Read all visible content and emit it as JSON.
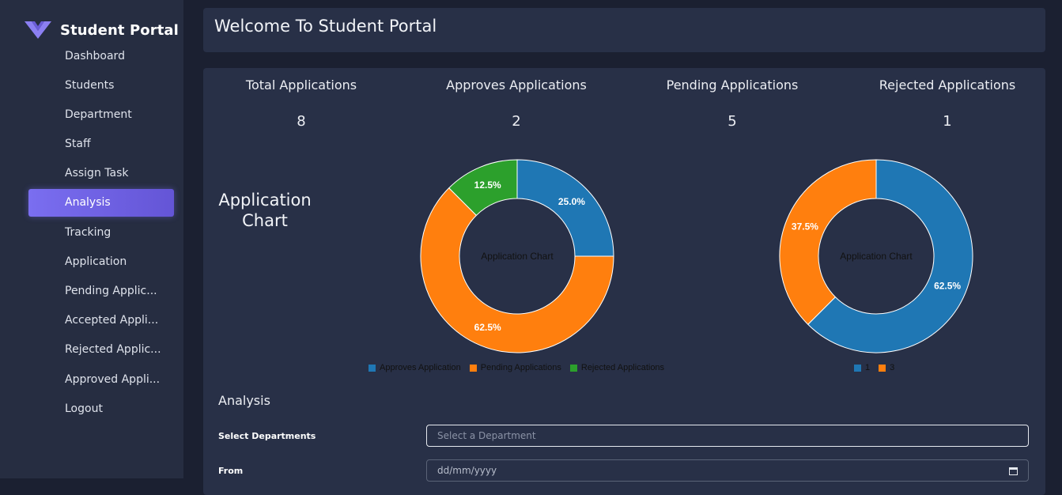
{
  "sidebar": {
    "brand": "Student Portal",
    "items": [
      {
        "label": "Dashboard"
      },
      {
        "label": "Students"
      },
      {
        "label": "Department"
      },
      {
        "label": "Staff"
      },
      {
        "label": "Assign Task"
      },
      {
        "label": "Analysis",
        "active": true
      },
      {
        "label": "Tracking"
      },
      {
        "label": "Application"
      },
      {
        "label": "Pending Applic..."
      },
      {
        "label": "Accepted Appli..."
      },
      {
        "label": "Rejected Applic..."
      },
      {
        "label": "Approved Appli..."
      },
      {
        "label": "Logout"
      }
    ]
  },
  "header": {
    "title": "Welcome To Student Portal"
  },
  "stats": [
    {
      "label": "Total Applications",
      "value": "8"
    },
    {
      "label": "Approves Applications",
      "value": "2"
    },
    {
      "label": "Pending Applications",
      "value": "5"
    },
    {
      "label": "Rejected Applications",
      "value": "1"
    }
  ],
  "section": {
    "chart_heading": "Application Chart"
  },
  "chart_data": [
    {
      "type": "pie",
      "title": "Application Chart",
      "categories": [
        "Approves Application",
        "Pending Applications",
        "Rejected Applications"
      ],
      "values": [
        25.0,
        62.5,
        12.5
      ],
      "labels": [
        "25.0%",
        "62.5%",
        "12.5%"
      ],
      "colors": [
        "#1f77b4",
        "#ff7f0e",
        "#2ca02c"
      ],
      "legend": "bottom"
    },
    {
      "type": "pie",
      "title": "Application Chart",
      "categories": [
        "1",
        "3"
      ],
      "values": [
        62.5,
        37.5
      ],
      "labels": [
        "62.5%",
        "37.5%"
      ],
      "colors": [
        "#1f77b4",
        "#ff7f0e"
      ],
      "legend": "bottom"
    }
  ],
  "analysis": {
    "title": "Analysis",
    "department_label": "Select Departments",
    "department_placeholder": "Select a Department",
    "from_label": "From",
    "from_placeholder": "dd/mm/yyyy"
  },
  "colors": {
    "accent": "#7a6ef0",
    "background": "#1b2031",
    "card": "#283047",
    "sidebar": "#262d41"
  }
}
